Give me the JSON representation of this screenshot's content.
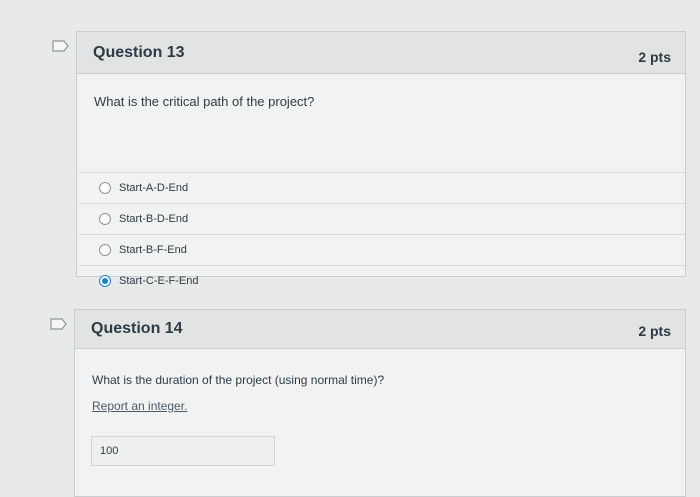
{
  "questions": [
    {
      "title": "Question 13",
      "points": "2 pts",
      "prompt": "What is the critical path of the project?",
      "answers": [
        {
          "label": "Start-A-D-End",
          "selected": false
        },
        {
          "label": "Start-B-D-End",
          "selected": false
        },
        {
          "label": "Start-B-F-End",
          "selected": false
        },
        {
          "label": "Start-C-E-F-End",
          "selected": true
        }
      ]
    },
    {
      "title": "Question 14",
      "points": "2 pts",
      "prompt": "What is the duration of the project (using normal time)?",
      "hint": "Report an integer.",
      "answer_value": "100"
    }
  ],
  "colors": {
    "accent": "#1b7fd3",
    "background": "#e8e9e9",
    "header": "#e2e4e4"
  }
}
